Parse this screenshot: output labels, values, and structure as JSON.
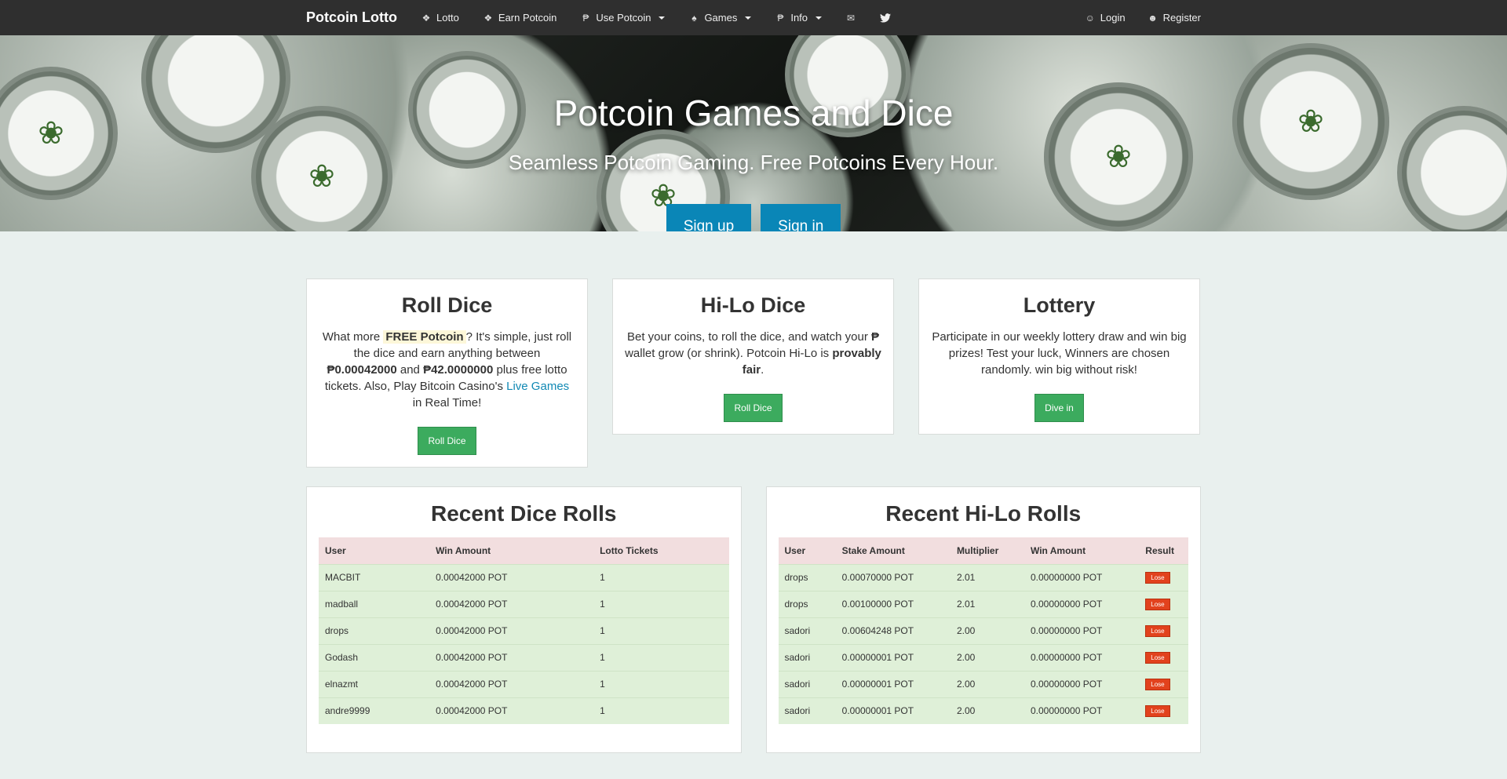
{
  "nav": {
    "brand": "Potcoin Lotto",
    "items": [
      {
        "label": "Lotto",
        "icon": "gift-icon",
        "glyph": "❖"
      },
      {
        "label": "Earn Potcoin",
        "icon": "gift-icon",
        "glyph": "❖"
      },
      {
        "label": "Use Potcoin",
        "icon": "potcoin-icon",
        "glyph": "₱"
      },
      {
        "label": "Games",
        "icon": "trophy-icon",
        "glyph": "♠"
      },
      {
        "label": "Info",
        "icon": "potcoin-icon",
        "glyph": "₱"
      }
    ],
    "envelope_glyph": "✉",
    "twitter_glyph": "✉",
    "login": "Login",
    "register": "Register",
    "user_glyph": "☺",
    "users_glyph": "☻"
  },
  "hero": {
    "title": "Potcoin Games and Dice",
    "subtitle": "Seamless Potcoin Gaming. Free Potcoins Every Hour.",
    "signup": "Sign up",
    "signin": "Sign in"
  },
  "cards": {
    "roll": {
      "title": "Roll Dice",
      "t1": "What more ",
      "free": "FREE Potcoin",
      "t2": "? It's simple, just roll the dice and earn anything between ",
      "min": "₱0.00042000",
      "t3": " and ",
      "max": "₱42.0000000",
      "t4": " plus free lotto tickets. Also, Play Bitcoin Casino's ",
      "link": "Live Games",
      "t5": " in Real Time!",
      "button": "Roll Dice"
    },
    "hilo": {
      "title": "Hi-Lo Dice",
      "t1": "Bet your coins, to roll the dice, and watch your ",
      "symbol": "₱",
      "t2": " wallet grow (or shrink). Potcoin Hi-Lo is ",
      "bold": "provably fair",
      "t3": ".",
      "button": "Roll Dice"
    },
    "lottery": {
      "title": "Lottery",
      "text": "Participate in our weekly lottery draw and win big prizes! Test your luck, Winners are chosen randomly. win big without risk!",
      "button": "Dive in"
    }
  },
  "dice_table": {
    "title": "Recent Dice Rolls",
    "headers": [
      "User",
      "Win Amount",
      "Lotto Tickets"
    ],
    "rows": [
      [
        "MACBIT",
        "0.00042000 POT",
        "1"
      ],
      [
        "madball",
        "0.00042000 POT",
        "1"
      ],
      [
        "drops",
        "0.00042000 POT",
        "1"
      ],
      [
        "Godash",
        "0.00042000 POT",
        "1"
      ],
      [
        "elnazmt",
        "0.00042000 POT",
        "1"
      ],
      [
        "andre9999",
        "0.00042000 POT",
        "1"
      ]
    ]
  },
  "hilo_table": {
    "title": "Recent Hi-Lo Rolls",
    "headers": [
      "User",
      "Stake Amount",
      "Multiplier",
      "Win Amount",
      "Result"
    ],
    "rows": [
      [
        "drops",
        "0.00070000 POT",
        "2.01",
        "0.00000000 POT",
        "Lose"
      ],
      [
        "drops",
        "0.00100000 POT",
        "2.01",
        "0.00000000 POT",
        "Lose"
      ],
      [
        "sadori",
        "0.00604248 POT",
        "2.00",
        "0.00000000 POT",
        "Lose"
      ],
      [
        "sadori",
        "0.00000001 POT",
        "2.00",
        "0.00000000 POT",
        "Lose"
      ],
      [
        "sadori",
        "0.00000001 POT",
        "2.00",
        "0.00000000 POT",
        "Lose"
      ],
      [
        "sadori",
        "0.00000001 POT",
        "2.00",
        "0.00000000 POT",
        "Lose"
      ]
    ]
  },
  "colors": {
    "navbar": "#2f2f2f",
    "hero_button": "#0a86b7",
    "green_button": "#3cab5e",
    "row_success": "#dff0d8",
    "header_danger": "#f2dedf",
    "lose_label": "#e2421d"
  }
}
